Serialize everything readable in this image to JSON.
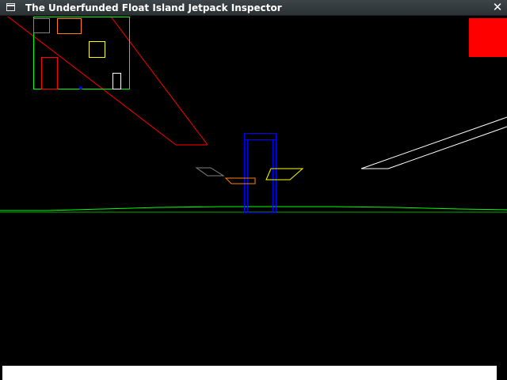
{
  "window": {
    "title": "The Underfunded Float Island Jetpack Inspector",
    "close_glyph": "✕",
    "icon": "window-menu-icon"
  },
  "scene": {
    "background_color": "#000000",
    "horizon_color": "#00ff00",
    "status_indicator_color": "#ff0000",
    "minimap_border_color": "#00ff00",
    "player_marker_color": "#0000ff",
    "view_cone_color": "#ff0000",
    "objects": [
      {
        "name": "tower",
        "color": "#0000ff"
      },
      {
        "name": "gray-platform",
        "color": "#808080"
      },
      {
        "name": "orange-platform",
        "color": "#ff8000"
      },
      {
        "name": "yellow-platform",
        "color": "#ffff00"
      },
      {
        "name": "white-ramp",
        "color": "#ffffff"
      }
    ]
  },
  "bottom_bar": {
    "color": "#ffffff"
  }
}
